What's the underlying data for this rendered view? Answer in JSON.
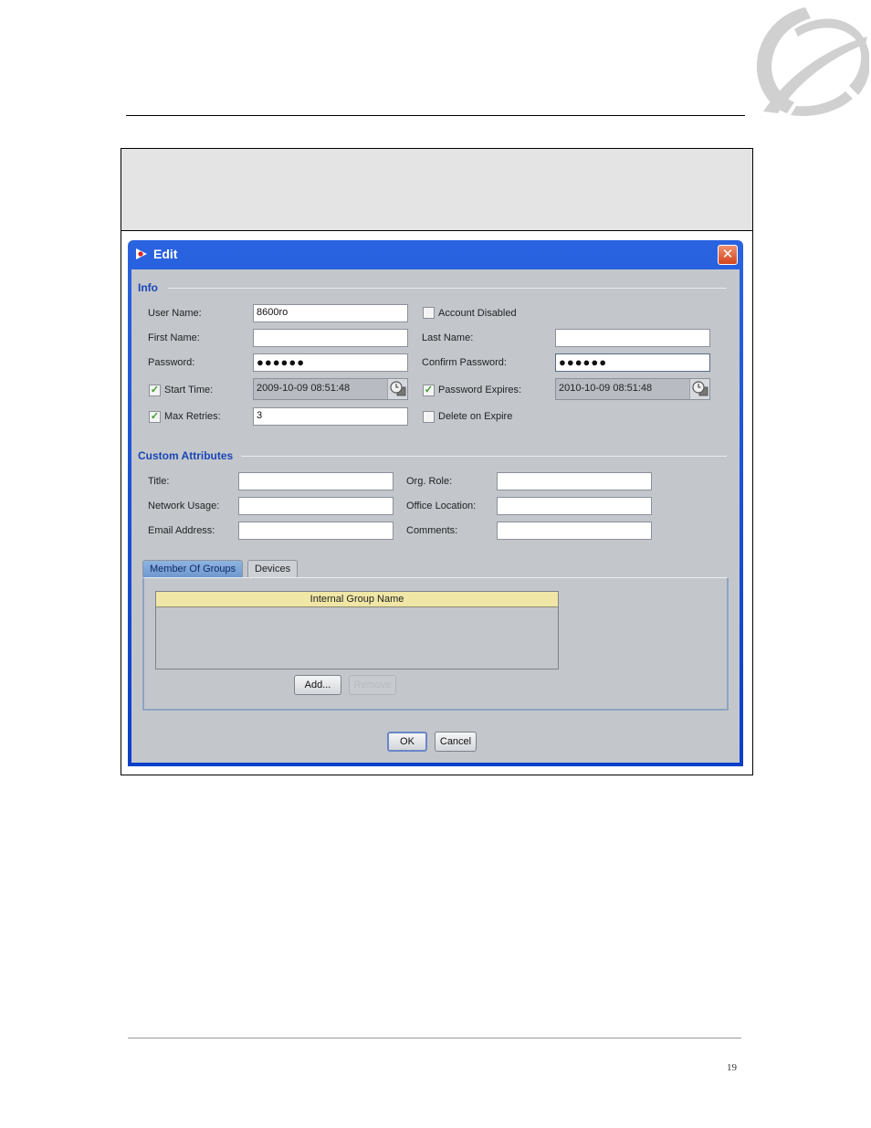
{
  "page": {
    "page_number": "19",
    "logo": "nortel-globemark-logo"
  },
  "dialog": {
    "title": "Edit",
    "close_label": "✕",
    "info": {
      "section_title": "Info",
      "user_name_label": "User Name:",
      "user_name_value": "8600ro",
      "account_disabled_label": "Account Disabled",
      "account_disabled_checked": false,
      "first_name_label": "First Name:",
      "first_name_value": "",
      "last_name_label": "Last Name:",
      "last_name_value": "",
      "password_label": "Password:",
      "password_value": "●●●●●●",
      "confirm_password_label": "Confirm Password:",
      "confirm_password_value": "●●●●●●",
      "start_time_label": "Start Time:",
      "start_time_checked": true,
      "start_time_value": "2009-10-09 08:51:48",
      "password_expires_label": "Password Expires:",
      "password_expires_checked": true,
      "password_expires_value": "2010-10-09 08:51:48",
      "max_retries_label": "Max Retries:",
      "max_retries_checked": true,
      "max_retries_value": "3",
      "delete_on_expire_label": "Delete on Expire",
      "delete_on_expire_checked": false
    },
    "custom": {
      "section_title": "Custom Attributes",
      "title_label": "Title:",
      "title_value": "",
      "org_role_label": "Org. Role:",
      "org_role_value": "",
      "network_usage_label": "Network Usage:",
      "network_usage_value": "",
      "office_location_label": "Office Location:",
      "office_location_value": "",
      "email_label": "Email Address:",
      "email_value": "",
      "comments_label": "Comments:",
      "comments_value": ""
    },
    "tabs": [
      {
        "label": "Member Of Groups",
        "active": true
      },
      {
        "label": "Devices",
        "active": false
      }
    ],
    "groups_table": {
      "columns": [
        "Internal Group Name"
      ],
      "rows": []
    },
    "add_label": "Add...",
    "remove_label": "Remove",
    "ok_label": "OK",
    "cancel_label": "Cancel"
  }
}
